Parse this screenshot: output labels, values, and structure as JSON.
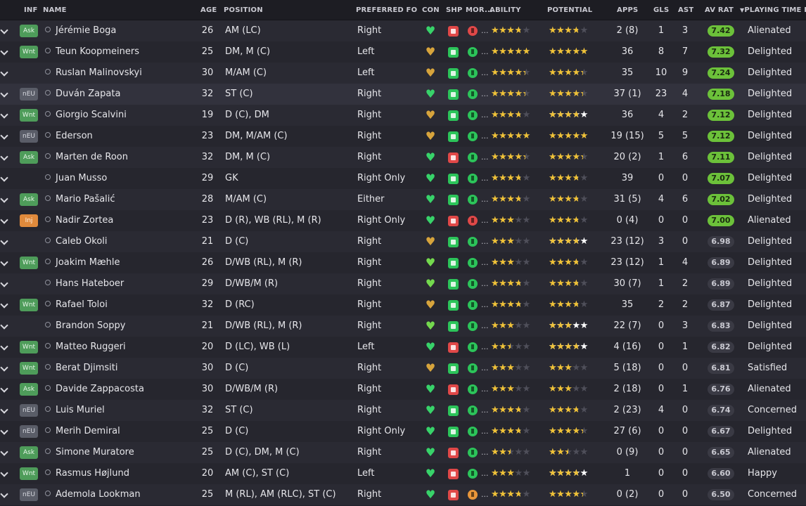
{
  "headers": {
    "inf": "INF",
    "name": "NAME",
    "age": "AGE",
    "position": "POSITION",
    "foot": "PREFERRED FO...",
    "con": "CON",
    "shp": "SHP",
    "mor": "MOR...",
    "ability": "ABILITY",
    "potential": "POTENTIAL",
    "apps": "APPS",
    "gls": "GLS",
    "ast": "AST",
    "avrat": "AV RAT",
    "playtime": "PLAYING TIME HA"
  },
  "colors": {
    "background": "#25252d",
    "header": "#1d1d23",
    "star": "#f0c237",
    "rating_green": "#6cc13a",
    "heart_green": "#38d36a",
    "heart_gold": "#d7a43c"
  },
  "rows": [
    {
      "inf": "Ask",
      "name": "Jérémie Boga",
      "age": "26",
      "position": "AM (LC)",
      "foot": "Right",
      "con": "green",
      "shp": "red",
      "mor": "red",
      "ability": 3,
      "potential": 3,
      "pot_extra": 0,
      "apps": "2 (8)",
      "gls": "1",
      "ast": "3",
      "avrat": "7.42",
      "good": true,
      "playtime": "Alienated"
    },
    {
      "inf": "Wnt",
      "name": "Teun Koopmeiners",
      "age": "25",
      "position": "DM, M (C)",
      "foot": "Left",
      "con": "gold",
      "shp": "green",
      "mor": "green",
      "ability": 4.5,
      "potential": 4.5,
      "pot_extra": 0,
      "apps": "36",
      "gls": "8",
      "ast": "7",
      "avrat": "7.32",
      "good": true,
      "playtime": "Delighted"
    },
    {
      "inf": "",
      "name": "Ruslan Malinovskyi",
      "age": "30",
      "position": "M/AM (C)",
      "foot": "Left",
      "con": "gold",
      "shp": "green",
      "mor": "green",
      "ability": 3.5,
      "potential": 3.5,
      "pot_extra": 0,
      "apps": "35",
      "gls": "10",
      "ast": "9",
      "avrat": "7.24",
      "good": true,
      "playtime": "Delighted"
    },
    {
      "inf": "nEU",
      "name": "Duván Zapata",
      "age": "32",
      "position": "ST (C)",
      "foot": "Right",
      "con": "green",
      "shp": "green",
      "mor": "green",
      "ability": 3.5,
      "potential": 3.5,
      "pot_extra": 0,
      "apps": "37 (1)",
      "gls": "23",
      "ast": "4",
      "avrat": "7.18",
      "good": true,
      "playtime": "Delighted"
    },
    {
      "inf": "Wnt",
      "name": "Giorgio Scalvini",
      "age": "19",
      "position": "D (C), DM",
      "foot": "Right",
      "con": "gold",
      "shp": "green",
      "mor": "green",
      "ability": 3,
      "potential": 3,
      "pot_extra": 1,
      "apps": "36",
      "gls": "4",
      "ast": "2",
      "avrat": "7.12",
      "good": true,
      "playtime": "Delighted"
    },
    {
      "inf": "nEU",
      "name": "Ederson",
      "age": "23",
      "position": "DM, M/AM (C)",
      "foot": "Right",
      "con": "gold",
      "shp": "green",
      "mor": "green",
      "ability": 4,
      "potential": 4,
      "pot_extra": 0,
      "apps": "19 (15)",
      "gls": "5",
      "ast": "5",
      "avrat": "7.12",
      "good": true,
      "playtime": "Delighted"
    },
    {
      "inf": "Ask",
      "name": "Marten de Roon",
      "age": "32",
      "position": "DM, M (C)",
      "foot": "Right",
      "con": "green",
      "shp": "red",
      "mor": "green",
      "ability": 3.5,
      "potential": 3.5,
      "pot_extra": 0,
      "apps": "20 (2)",
      "gls": "1",
      "ast": "6",
      "avrat": "7.11",
      "good": true,
      "playtime": "Delighted"
    },
    {
      "inf": "",
      "name": "Juan Musso",
      "age": "29",
      "position": "GK",
      "foot": "Right Only",
      "con": "green",
      "shp": "green",
      "mor": "green",
      "ability": 3,
      "potential": 3,
      "pot_extra": 0,
      "apps": "39",
      "gls": "0",
      "ast": "0",
      "avrat": "7.07",
      "good": true,
      "playtime": "Delighted"
    },
    {
      "inf": "Ask",
      "name": "Mario Pašalić",
      "age": "28",
      "position": "M/AM (C)",
      "foot": "Either",
      "con": "green",
      "shp": "green",
      "mor": "green",
      "ability": 3,
      "potential": 3,
      "pot_extra": 0,
      "apps": "31 (5)",
      "gls": "4",
      "ast": "6",
      "avrat": "7.02",
      "good": true,
      "playtime": "Delighted"
    },
    {
      "inf": "Inj",
      "name": "Nadir Zortea",
      "age": "23",
      "position": "D (R), WB (RL), M (R)",
      "foot": "Right Only",
      "con": "green",
      "shp": "red",
      "mor": "red",
      "ability": 2.5,
      "potential": 3,
      "pot_extra": 0,
      "apps": "0 (4)",
      "gls": "0",
      "ast": "0",
      "avrat": "7.00",
      "good": true,
      "playtime": "Alienated"
    },
    {
      "inf": "",
      "name": "Caleb Okoli",
      "age": "21",
      "position": "D (C)",
      "foot": "Right",
      "con": "gold",
      "shp": "green",
      "mor": "green",
      "ability": 2.5,
      "potential": 3,
      "pot_extra": 1.5,
      "apps": "23 (12)",
      "gls": "3",
      "ast": "0",
      "avrat": "6.98",
      "good": false,
      "playtime": "Delighted"
    },
    {
      "inf": "Wnt",
      "name": "Joakim Mæhle",
      "age": "26",
      "position": "D/WB (RL), M (R)",
      "foot": "Right",
      "con": "lime",
      "shp": "green",
      "mor": "green",
      "ability": 2.5,
      "potential": 3,
      "pot_extra": 0,
      "apps": "23 (12)",
      "gls": "1",
      "ast": "4",
      "avrat": "6.89",
      "good": false,
      "playtime": "Delighted"
    },
    {
      "inf": "",
      "name": "Hans Hateboer",
      "age": "29",
      "position": "D/WB/M (R)",
      "foot": "Right",
      "con": "lime",
      "shp": "green",
      "mor": "green",
      "ability": 3,
      "potential": 3,
      "pot_extra": 0,
      "apps": "30 (7)",
      "gls": "1",
      "ast": "2",
      "avrat": "6.89",
      "good": false,
      "playtime": "Delighted"
    },
    {
      "inf": "Wnt",
      "name": "Rafael Toloi",
      "age": "32",
      "position": "D (RC)",
      "foot": "Right",
      "con": "gold",
      "shp": "green",
      "mor": "green",
      "ability": 3,
      "potential": 3,
      "pot_extra": 0,
      "apps": "35",
      "gls": "2",
      "ast": "2",
      "avrat": "6.87",
      "good": false,
      "playtime": "Delighted"
    },
    {
      "inf": "",
      "name": "Brandon Soppy",
      "age": "21",
      "position": "D/WB (RL), M (R)",
      "foot": "Right",
      "con": "lime",
      "shp": "green",
      "mor": "green",
      "ability": 2.5,
      "potential": 2.5,
      "pot_extra": 1.5,
      "apps": "22 (7)",
      "gls": "0",
      "ast": "3",
      "avrat": "6.83",
      "good": false,
      "playtime": "Delighted"
    },
    {
      "inf": "Wnt",
      "name": "Matteo Ruggeri",
      "age": "20",
      "position": "D (LC), WB (L)",
      "foot": "Left",
      "con": "green",
      "shp": "red",
      "mor": "green",
      "ability": 2,
      "potential": 3,
      "pot_extra": 1,
      "apps": "4 (16)",
      "gls": "0",
      "ast": "1",
      "avrat": "6.82",
      "good": false,
      "playtime": "Delighted"
    },
    {
      "inf": "Wnt",
      "name": "Berat Djimsiti",
      "age": "30",
      "position": "D (C)",
      "foot": "Right",
      "con": "gold",
      "shp": "green",
      "mor": "green",
      "ability": 2.5,
      "potential": 2.5,
      "pot_extra": 0,
      "apps": "5 (18)",
      "gls": "0",
      "ast": "0",
      "avrat": "6.81",
      "good": false,
      "playtime": "Satisfied"
    },
    {
      "inf": "Ask",
      "name": "Davide Zappacosta",
      "age": "30",
      "position": "D/WB/M (R)",
      "foot": "Right",
      "con": "green",
      "shp": "red",
      "mor": "green",
      "ability": 2.5,
      "potential": 2.5,
      "pot_extra": 0,
      "apps": "2 (18)",
      "gls": "0",
      "ast": "1",
      "avrat": "6.76",
      "good": false,
      "playtime": "Alienated"
    },
    {
      "inf": "nEU",
      "name": "Luis Muriel",
      "age": "32",
      "position": "ST (C)",
      "foot": "Right",
      "con": "green",
      "shp": "green",
      "mor": "green",
      "ability": 3,
      "potential": 3,
      "pot_extra": 0,
      "apps": "2 (23)",
      "gls": "4",
      "ast": "0",
      "avrat": "6.74",
      "good": false,
      "playtime": "Concerned"
    },
    {
      "inf": "nEU",
      "name": "Merih Demiral",
      "age": "25",
      "position": "D (C)",
      "foot": "Right Only",
      "con": "green",
      "shp": "green",
      "mor": "green",
      "ability": 3,
      "potential": 3.5,
      "pot_extra": 0,
      "apps": "27 (6)",
      "gls": "0",
      "ast": "0",
      "avrat": "6.67",
      "good": false,
      "playtime": "Delighted"
    },
    {
      "inf": "Ask",
      "name": "Simone Muratore",
      "age": "25",
      "position": "D (C), DM, M (C)",
      "foot": "Right",
      "con": "green",
      "shp": "red",
      "mor": "green",
      "ability": 2,
      "potential": 2,
      "pot_extra": 0,
      "apps": "0 (9)",
      "gls": "0",
      "ast": "0",
      "avrat": "6.65",
      "good": false,
      "playtime": "Alienated"
    },
    {
      "inf": "Wnt",
      "name": "Rasmus Højlund",
      "age": "20",
      "position": "AM (C), ST (C)",
      "foot": "Left",
      "con": "green",
      "shp": "red",
      "mor": "green",
      "ability": 2.5,
      "potential": 3,
      "pot_extra": 1,
      "apps": "1",
      "gls": "0",
      "ast": "0",
      "avrat": "6.60",
      "good": false,
      "playtime": "Happy"
    },
    {
      "inf": "nEU",
      "name": "Ademola Lookman",
      "age": "25",
      "position": "M (RL), AM (RLC), ST (C)",
      "foot": "Right",
      "con": "green",
      "shp": "red",
      "mor": "orange",
      "ability": 3,
      "potential": 3.5,
      "pot_extra": 0,
      "apps": "0 (2)",
      "gls": "0",
      "ast": "0",
      "avrat": "6.50",
      "good": false,
      "playtime": "Concerned"
    }
  ]
}
